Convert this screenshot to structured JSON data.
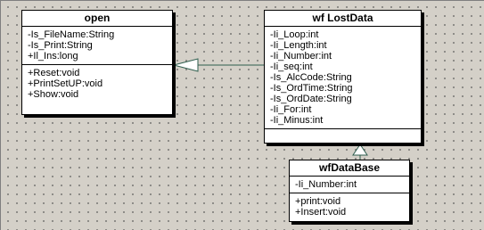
{
  "diagram": {
    "classes": {
      "open": {
        "name": "open",
        "attributes": [
          "-Is_FileName:String",
          "-Is_Print:String",
          "+Il_Ins:long"
        ],
        "operations": [
          "+Reset:void",
          "+PrintSetUP:void",
          "+Show:void"
        ]
      },
      "lostdata": {
        "name": "wf LostData",
        "attributes": [
          "-Ii_Loop:int",
          "-Ii_Length:int",
          "-Ii_Number:int",
          "-Ii_seq:int",
          "-Is_AlcCode:String",
          "-Is_OrdTime:String",
          "-Is_OrdDate:String",
          "-Ii_For:int",
          "-Ii_Minus:int"
        ],
        "operations": []
      },
      "database": {
        "name": "wfDataBase",
        "attributes": [
          "-Ii_Number:int"
        ],
        "operations": [
          "+print:void",
          "+Insert:void"
        ]
      }
    },
    "relations": [
      {
        "from": "wf LostData",
        "to": "open",
        "kind": "generalization"
      },
      {
        "from": "wfDataBase",
        "to": "wf LostData",
        "kind": "generalization"
      }
    ]
  },
  "colors": {
    "canvas": "#d4d0c8",
    "grid_dot": "#5e5e5e",
    "box": "#ffffff",
    "border": "#000000",
    "connector": "#2e5e4e"
  }
}
